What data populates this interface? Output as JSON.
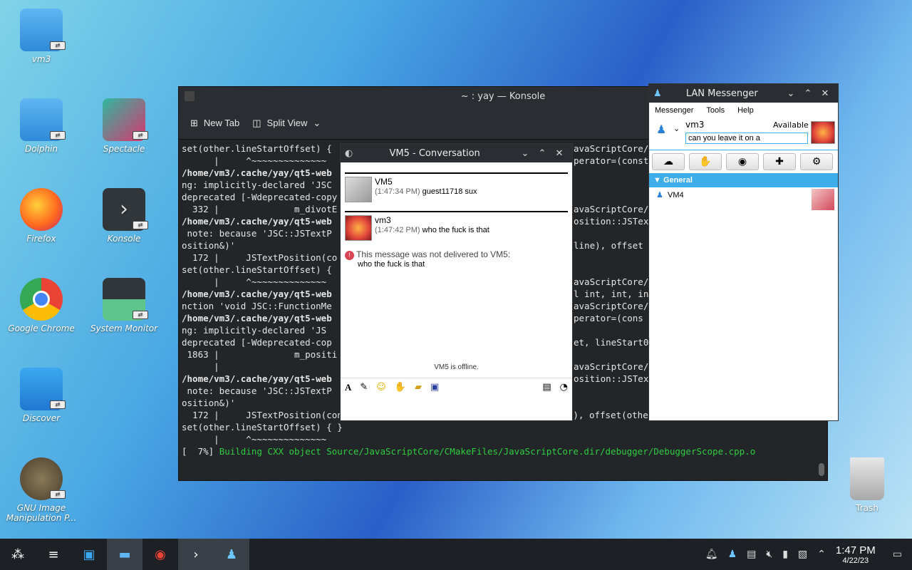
{
  "desktop": {
    "icons": [
      {
        "label": "vm3"
      },
      {
        "label": "Dolphin"
      },
      {
        "label": "Spectacle"
      },
      {
        "label": "Firefox"
      },
      {
        "label": "Konsole"
      },
      {
        "label": "Google Chrome"
      },
      {
        "label": "System Monitor"
      },
      {
        "label": "Discover"
      },
      {
        "label": "GNU Image Manipulation P..."
      },
      {
        "label": "Trash"
      }
    ]
  },
  "konsole": {
    "title": "~ : yay — Konsole",
    "toolbar": {
      "new_tab": "New Tab",
      "split_view": "Split View"
    },
    "lines": [
      "set(other.lineStartOffset) {",
      "      |     ^~~~~~~~~~~~~~~",
      "/home/vm3/.cache/yay/qt5-web",
      "ng: implicitly-declared 'JSC",
      "deprecated [-Wdeprecated-copy",
      "  332 |              m_divotE",
      "",
      "/home/vm3/.cache/yay/qt5-web",
      " note: because 'JSC::JSTextP",
      "osition&)'",
      "  172 |     JSTextPosition(co",
      "set(other.lineStartOffset) {",
      "      |     ^~~~~~~~~~~~~~~",
      "/home/vm3/.cache/yay/qt5-web",
      "nction 'void JSC::FunctionMe",
      "/home/vm3/.cache/yay/qt5-web",
      "ng: implicitly-declared 'JS",
      "deprecated [-Wdeprecated-cop",
      " 1863 |              m_positi",
      "      |",
      "/home/vm3/.cache/yay/qt5-web",
      " note: because 'JSC::JSTextP",
      "osition&)'",
      "  172 |     JSTextPosition(const JSTextPosition& other) : line(other.line), offset(other.offset), lineStartOff",
      "set(other.lineStartOffset) { }",
      "      |     ^~~~~~~~~~~~~~~",
      "[  7%] Building CXX object Source/JavaScriptCore/CMakeFiles/JavaScriptCore.dir/debugger/DebuggerScope.cpp.o"
    ],
    "right_lines": [
      "avaScriptCore/",
      "perator=(const",
      "",
      "",
      "",
      "avaScriptCore/",
      "osition::JSTex",
      "",
      "line), offset",
      "",
      "",
      "avaScriptCore/",
      "l int, int, in",
      "avaScriptCore/",
      "perator=(cons",
      "",
      "et, lineStart0",
      "",
      "avaScriptCore/",
      "osition::JSTex"
    ]
  },
  "conversation": {
    "title": "VM5 - Conversation",
    "messages": [
      {
        "name": "VM5",
        "time": "(1:47:34 PM)",
        "text": "guest11718 sux"
      },
      {
        "name": "vm3",
        "time": "(1:47:42 PM)",
        "text": "who the fuck is that"
      }
    ],
    "error_title": "This message was not delivered to VM5:",
    "error_text": "who the fuck is that",
    "offline_notice": "VM5 is offline."
  },
  "lan_messenger": {
    "title": "LAN Messenger",
    "menu": [
      "Messenger",
      "Tools",
      "Help"
    ],
    "user_name": "vm3",
    "status": "Available",
    "status_message": "can you leave it on a",
    "group": "General",
    "contacts": [
      {
        "name": "VM4"
      }
    ]
  },
  "taskbar": {
    "time": "1:47 PM",
    "date": "4/22/23"
  }
}
